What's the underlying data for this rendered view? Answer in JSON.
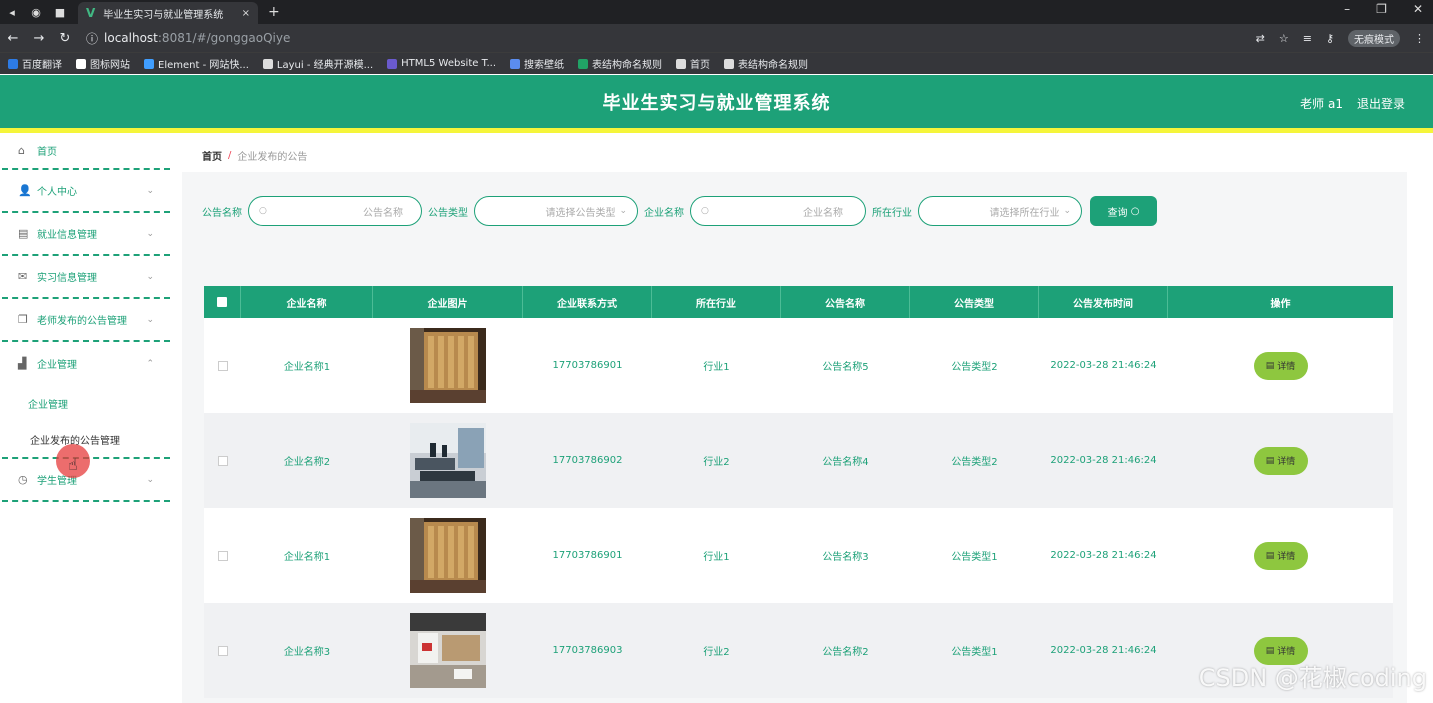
{
  "browser": {
    "tab_title": "毕业生实习与就业管理系统",
    "tab_close": "×",
    "new_tab": "+",
    "url_host": "localhost",
    "url_path": ":8081/#/gonggaoQiye",
    "incognito_label": "无痕模式",
    "bookmarks": [
      {
        "label": "百度翻译",
        "color": "#2d7be5"
      },
      {
        "label": "图标网站",
        "color": "#ffffff"
      },
      {
        "label": "Element - 网站快...",
        "color": "#409eff"
      },
      {
        "label": "Layui - 经典开源模...",
        "color": "#dddddd"
      },
      {
        "label": "HTML5 Website T...",
        "color": "#6a5acd"
      },
      {
        "label": "搜索壁纸",
        "color": "#5b8def"
      },
      {
        "label": "表结构命名规则",
        "color": "#21a366"
      },
      {
        "label": "首页",
        "color": "#dddddd"
      },
      {
        "label": "表结构命名规则",
        "color": "#dddddd"
      }
    ]
  },
  "header": {
    "title": "毕业生实习与就业管理系统",
    "user": "老师 a1",
    "logout": "退出登录"
  },
  "sidebar": {
    "items": [
      {
        "label": "首页",
        "icon": "home-icon"
      },
      {
        "label": "个人中心",
        "icon": "user-icon"
      },
      {
        "label": "就业信息管理",
        "icon": "clipboard-icon"
      },
      {
        "label": "实习信息管理",
        "icon": "mail-icon"
      },
      {
        "label": "老师发布的公告管理",
        "icon": "copy-icon"
      },
      {
        "label": "企业管理",
        "icon": "thumb-icon"
      },
      {
        "label": "学生管理",
        "icon": "clock-icon"
      }
    ],
    "sub_items": [
      "企业管理",
      "企业发布的公告管理"
    ]
  },
  "breadcrumb": {
    "home": "首页",
    "separator": "/",
    "current": "企业发布的公告"
  },
  "filters": {
    "name_label": "公告名称",
    "name_placeholder": "公告名称",
    "type_label": "公告类型",
    "type_placeholder": "请选择公告类型",
    "company_label": "企业名称",
    "company_placeholder": "企业名称",
    "industry_label": "所在行业",
    "industry_placeholder": "请选择所在行业",
    "query_button": "查询"
  },
  "table": {
    "columns": [
      "企业名称",
      "企业图片",
      "企业联系方式",
      "所在行业",
      "公告名称",
      "公告类型",
      "公告发布时间",
      "操作"
    ],
    "detail_label": "详情",
    "rows": [
      {
        "company": "企业名称1",
        "image": "office-lobby",
        "phone": "17703786901",
        "industry": "行业1",
        "notice": "公告名称5",
        "type": "公告类型2",
        "time": "2022-03-28 21:46:24"
      },
      {
        "company": "企业名称2",
        "image": "office-desks",
        "phone": "17703786902",
        "industry": "行业2",
        "notice": "公告名称4",
        "type": "公告类型2",
        "time": "2022-03-28 21:46:24"
      },
      {
        "company": "企业名称1",
        "image": "office-lobby",
        "phone": "17703786901",
        "industry": "行业1",
        "notice": "公告名称3",
        "type": "公告类型1",
        "time": "2022-03-28 21:46:24"
      },
      {
        "company": "企业名称3",
        "image": "office-hall",
        "phone": "17703786903",
        "industry": "行业2",
        "notice": "公告名称2",
        "type": "公告类型1",
        "time": "2022-03-28 21:46:24"
      }
    ]
  },
  "watermark": "CSDN @花椒coding"
}
